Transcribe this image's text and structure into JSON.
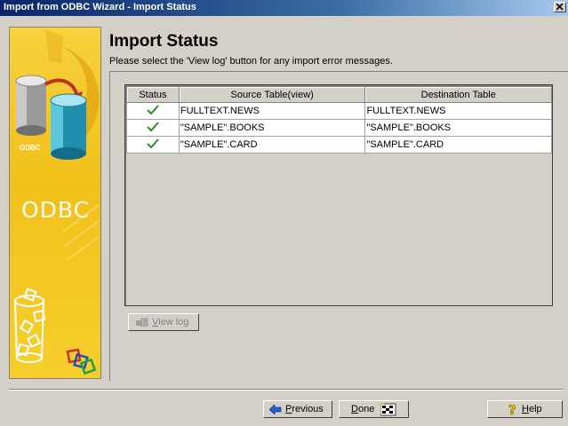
{
  "window": {
    "title": "Import from ODBC Wizard - Import Status"
  },
  "sidebar": {
    "logo_text": "ODBC",
    "small_label": "ODBC"
  },
  "header": {
    "title": "Import Status",
    "subtitle": "Please select the 'View log' button for any import error messages."
  },
  "table": {
    "columns": [
      "Status",
      "Source Table(view)",
      "Destination Table"
    ],
    "rows": [
      {
        "status": "success",
        "source": "FULLTEXT.NEWS",
        "destination": "FULLTEXT.NEWS"
      },
      {
        "status": "success",
        "source": "\"SAMPLE\".BOOKS",
        "destination": "\"SAMPLE\".BOOKS"
      },
      {
        "status": "success",
        "source": "\"SAMPLE\".CARD",
        "destination": "\"SAMPLE\".CARD"
      }
    ]
  },
  "buttons": {
    "view_log_mnemonic": "V",
    "view_log_rest": "iew log",
    "previous_mnemonic": "P",
    "previous_rest": "revious",
    "done_mnemonic": "D",
    "done_rest": "one",
    "help_mnemonic": "H",
    "help_rest": "elp"
  },
  "icons": {
    "status_ok": "checkmark-icon",
    "view_log": "log-icon",
    "previous": "left-arrow-icon",
    "done": "finish-flag-icon",
    "help": "help-question-icon",
    "close": "close-icon"
  },
  "colors": {
    "titlebar_start": "#0a246a",
    "titlebar_end": "#a6caf0",
    "panel_yellow": "#f2c01a",
    "check_green": "#2e8b20"
  }
}
